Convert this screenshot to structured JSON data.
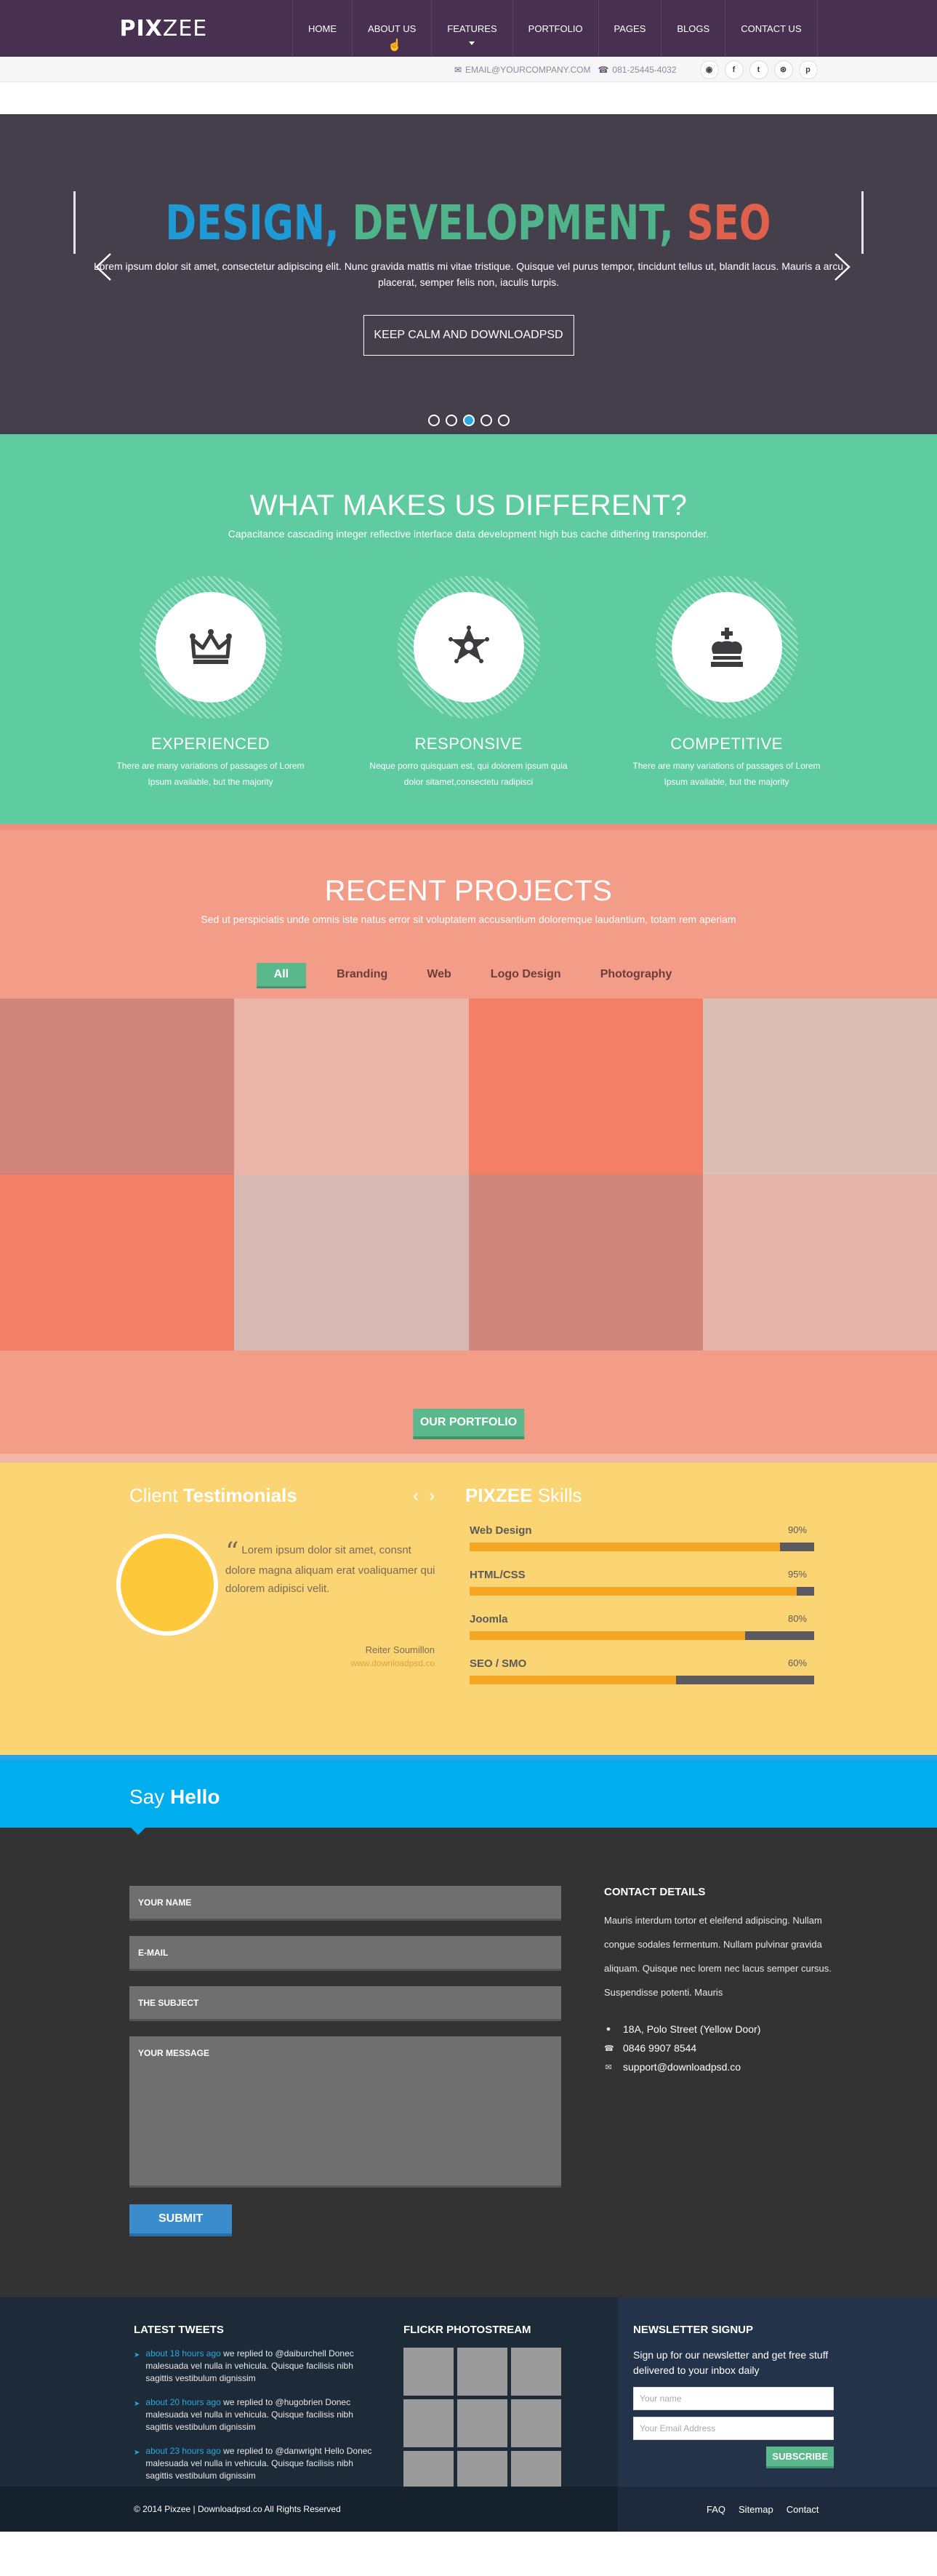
{
  "header": {
    "logo_bold": "PIX",
    "logo_light": "ZEE",
    "nav": [
      "HOME",
      "ABOUT US",
      "FEATURES",
      "PORTFOLIO",
      "PAGES",
      "BLOGS",
      "CONTACT US"
    ],
    "email": "EMAIL@YOURCOMPANY.COM",
    "phone": "081-25445-4032",
    "social_icons": [
      "rss-icon",
      "facebook-icon",
      "twitter-icon",
      "dribbble-icon",
      "pinterest-icon"
    ]
  },
  "hero": {
    "title_part1": "DESIGN,",
    "title_part2": "DEVELOPMENT,",
    "title_part3": "SEO",
    "text": "Lorem ipsum dolor sit amet, consectetur adipiscing elit. Nunc gravida mattis mi vitae tristique. Quisque vel purus tempor, tincidunt tellus ut, blandit lacus. Mauris a arcu placerat, semper felis non, iaculis turpis.",
    "button": "KEEP CALM AND DOWNLOADPSD",
    "slide_count": 5,
    "active_slide": 3,
    "colors": {
      "title1": "#1e9bd7",
      "title2": "#4fb48a",
      "title3": "#e0614b",
      "background": "#453f4c"
    }
  },
  "different": {
    "title": "WHAT MAKES US DIFFERENT?",
    "subtitle": "Capacitance cascading integer reflective interface data development high bus cache dithering transponder.",
    "features": [
      {
        "icon": "crown-icon",
        "title": "EXPERIENCED",
        "text": "There are many variations of passages of Lorem Ipsum available, but the majority"
      },
      {
        "icon": "sheriff-star-icon",
        "title": "RESPONSIVE",
        "text": "Neque porro quisquam est, qui dolorem ipsum quia dolor sitamet,consectetu radipisci"
      },
      {
        "icon": "chess-king-icon",
        "title": "COMPETITIVE",
        "text": "There are many variations of passages of Lorem Ipsum available, but the majority"
      }
    ]
  },
  "projects": {
    "title": "RECENT PROJECTS",
    "subtitle": "Sed ut perspiciatis unde omnis iste natus error sit voluptatem accusantium doloremque laudantium, totam rem aperiam",
    "filters": [
      "All",
      "Branding",
      "Web",
      "Logo Design",
      "Photography"
    ],
    "active_filter": "All",
    "tile_colors": [
      "#d0867a",
      "#ebb4a9",
      "#f37f66",
      "#dbbfb7",
      "#f37f66",
      "#d7b9b4",
      "#d0867a",
      "#e7b4a9"
    ],
    "button": "OUR PORTFOLIO"
  },
  "testimonials": {
    "title_light": "Client",
    "title_bold": "Testimonials",
    "quote": "Lorem ipsum dolor sit amet, consnt dolore magna aliquam erat voaliquamer qui dolorem adipisci velit.",
    "author": "Reiter Soumillon",
    "site": "www.downloadpsd.co"
  },
  "skills": {
    "title_bold_prefix": "PIXZEE",
    "title": "Skills",
    "items": [
      {
        "name": "Web Design",
        "percent_label": "90%",
        "value": 90
      },
      {
        "name": "HTML/CSS",
        "percent_label": "95%",
        "value": 95
      },
      {
        "name": "Joomla",
        "percent_label": "80%",
        "value": 80
      },
      {
        "name": "SEO / SMO",
        "percent_label": "60%",
        "value": 60
      }
    ]
  },
  "hello": {
    "title_light": "Say",
    "title_bold": "Hello"
  },
  "contact": {
    "fields": [
      "YOUR NAME",
      "E-MAIL",
      "THE SUBJECT",
      "YOUR MESSAGE"
    ],
    "submit": "SUBMIT",
    "details_title": "CONTACT DETAILS",
    "details_text": "Mauris interdum tortor et eleifend adipiscing. Nullam congue sodales fermentum. Nullam pulvinar gravida aliquam. Quisque nec lorem nec lacus semper cursus. Suspendisse potenti. Mauris",
    "address": "18A, Polo Street (Yellow Door)",
    "phone": "0846 9907 8544",
    "email": "support@downloadpsd.co"
  },
  "footer": {
    "tweets_title": "LATEST TWEETS",
    "tweets": [
      {
        "time": "about 18 hours ago",
        "text": " we replied to @daiburchell Donec malesuada vel nulla in vehicula. Quisque facilisis nibh sagittis vestibulum dignissim"
      },
      {
        "time": "about 20 hours ago",
        "text": " we replied to @hugobrien Donec malesuada vel nulla in vehicula. Quisque facilisis nibh sagittis vestibulum dignissim"
      },
      {
        "time": "about 23 hours ago",
        "text": " we replied to @danwright Hello Donec malesuada vel nulla in vehicula. Quisque facilisis nibh sagittis vestibulum dignissim"
      }
    ],
    "flickr_title": "FLICKR PHOTOSTREAM",
    "newsletter_title": "NEWSLETTER SIGNUP",
    "newsletter_text": "Sign up for our newsletter and get free stuff delivered to your inbox daily",
    "name_placeholder": "Your name",
    "email_placeholder": "Your Email Address",
    "subscribe": "SUBSCRIBE",
    "copyright": "© 2014 Pixzee | Downloadpsd.co All Rights Reserved",
    "links": [
      "FAQ",
      "Sitemap",
      "Contact"
    ]
  }
}
